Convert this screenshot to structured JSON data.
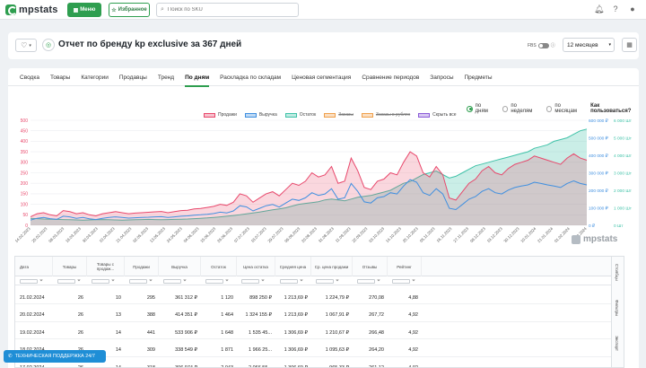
{
  "app": {
    "logo_text": "mpstats",
    "menu_label": "Меню",
    "favorites_label": "Избранное",
    "search_placeholder": "Поиск по SKU"
  },
  "header": {
    "title": "Отчет по бренду kp exclusive за 367 дней",
    "fbs_label": "FBS",
    "period_value": "12 месяцев"
  },
  "tabs": [
    {
      "label": "Сводка",
      "active": false
    },
    {
      "label": "Товары",
      "active": false
    },
    {
      "label": "Категории",
      "active": false
    },
    {
      "label": "Продавцы",
      "active": false
    },
    {
      "label": "Тренд",
      "active": false
    },
    {
      "label": "По дням",
      "active": true
    },
    {
      "label": "Раскладка по складам",
      "active": false
    },
    {
      "label": "Ценовая сегментация",
      "active": false
    },
    {
      "label": "Сравнение периодов",
      "active": false
    },
    {
      "label": "Запросы",
      "active": false
    },
    {
      "label": "Предметы",
      "active": false
    }
  ],
  "granularity": {
    "options": [
      "по дням",
      "по неделям",
      "по месяцам"
    ],
    "selected": "по дням",
    "help_label": "Как пользоваться?"
  },
  "legend": [
    {
      "label": "Продажи",
      "color": "#e8476b",
      "enabled": true
    },
    {
      "label": "Выручка",
      "color": "#3f8fe0",
      "enabled": true
    },
    {
      "label": "Остаток",
      "color": "#3fc2a8",
      "enabled": true
    },
    {
      "label": "Заказы",
      "color": "#f0a04b",
      "enabled": false
    },
    {
      "label": "Заказы в рублях",
      "color": "#f0a04b",
      "enabled": false
    },
    {
      "label": "Скрыть все",
      "color": "#8a5ad8",
      "enabled": true
    }
  ],
  "chart_data": {
    "type": "line",
    "left_axis_ticks": [
      "500",
      "450",
      "400",
      "350",
      "300",
      "250",
      "200",
      "150",
      "100",
      "50",
      "0"
    ],
    "right_axis_rub_ticks": [
      "600 000 ₽",
      "500 000 ₽",
      "400 000 ₽",
      "300 000 ₽",
      "200 000 ₽",
      "100 000 ₽",
      "0 ₽"
    ],
    "right_axis_qty_ticks": [
      "6 000 Шт",
      "5 000 Шт",
      "4 000 Шт",
      "3 000 Шт",
      "2 000 Шт",
      "1 000 Шт",
      "0 Шт"
    ],
    "x_labels": [
      "14.02.2023",
      "25.02.2023",
      "08.03.2023",
      "19.03.2023",
      "30.03.2023",
      "10.04.2023",
      "21.04.2023",
      "02.05.2023",
      "13.05.2023",
      "24.05.2023",
      "04.06.2023",
      "15.06.2023",
      "26.06.2023",
      "07.07.2023",
      "18.07.2023",
      "29.07.2023",
      "09.08.2023",
      "20.08.2023",
      "31.08.2023",
      "11.09.2023",
      "22.09.2023",
      "03.10.2023",
      "14.10.2023",
      "25.10.2023",
      "05.11.2023",
      "16.11.2023",
      "27.11.2023",
      "08.12.2023",
      "19.12.2023",
      "30.12.2023",
      "10.01.2024",
      "21.01.2024",
      "01.02.2024",
      "12.02.2024"
    ],
    "series": [
      {
        "name": "Продажи",
        "axis": "left",
        "values": [
          40,
          55,
          60,
          50,
          45,
          70,
          65,
          55,
          60,
          50,
          45,
          55,
          60,
          65,
          60,
          55,
          58,
          60,
          62,
          64,
          66,
          60,
          65,
          70,
          72,
          78,
          80,
          85,
          90,
          100,
          95,
          110,
          150,
          140,
          110,
          130,
          150,
          160,
          140,
          170,
          200,
          190,
          210,
          250,
          230,
          240,
          280,
          200,
          210,
          320,
          260,
          180,
          170,
          210,
          220,
          250,
          240,
          300,
          350,
          330,
          250,
          230,
          280,
          240,
          130,
          120,
          160,
          200,
          220,
          260,
          280,
          250,
          240,
          270,
          290,
          300,
          310,
          330,
          320,
          310,
          300,
          290,
          320,
          340,
          320,
          310
        ]
      },
      {
        "name": "Выручка",
        "axis": "right_rub",
        "values": [
          30000,
          40000,
          45000,
          38000,
          34000,
          52000,
          48000,
          40000,
          45000,
          37000,
          33000,
          40000,
          45000,
          48000,
          45000,
          41000,
          43000,
          45000,
          46000,
          48000,
          49000,
          45000,
          48000,
          52000,
          54000,
          58000,
          60000,
          63000,
          67000,
          75000,
          71000,
          82000,
          112000,
          105000,
          82000,
          97000,
          112000,
          119000,
          104000,
          127000,
          149000,
          142000,
          157000,
          186000,
          171000,
          179000,
          209000,
          149000,
          157000,
          239000,
          194000,
          134000,
          127000,
          157000,
          164000,
          186000,
          179000,
          224000,
          261000,
          246000,
          186000,
          171000,
          209000,
          179000,
          97000,
          90000,
          119000,
          149000,
          164000,
          194000,
          209000,
          186000,
          179000,
          201000,
          216000,
          224000,
          231000,
          246000,
          239000,
          231000,
          224000,
          216000,
          239000,
          254000,
          239000,
          231000
        ]
      },
      {
        "name": "Остаток",
        "axis": "right_qty",
        "values": [
          400,
          380,
          360,
          350,
          340,
          330,
          320,
          310,
          300,
          310,
          320,
          330,
          320,
          310,
          300,
          310,
          320,
          330,
          340,
          330,
          320,
          330,
          340,
          350,
          360,
          380,
          400,
          420,
          450,
          480,
          520,
          560,
          600,
          650,
          700,
          760,
          820,
          880,
          940,
          1000,
          1100,
          1200,
          1250,
          1300,
          1350,
          1450,
          1500,
          1450,
          1400,
          1500,
          1600,
          1650,
          1700,
          1800,
          1900,
          2000,
          2200,
          2400,
          2500,
          2700,
          2900,
          3000,
          3100,
          2900,
          2700,
          2800,
          3000,
          3200,
          3400,
          3500,
          3600,
          3700,
          3800,
          3900,
          4000,
          4100,
          4200,
          4400,
          4500,
          4600,
          4800,
          4900,
          5000,
          5200,
          5400,
          5500
        ]
      }
    ]
  },
  "table": {
    "columns": [
      "Дата",
      "Товары",
      "Товары с продаж...",
      "Продажи",
      "Выручка",
      "Остаток",
      "Цена остатка",
      "Средняя цена",
      "Ср. цена продажи",
      "Отзывы",
      "Рейтинг"
    ],
    "rows": [
      [
        "21.02.2024",
        "26",
        "10",
        "295",
        "361 312 ₽",
        "1 120",
        "898 250 ₽",
        "1 213,69 ₽",
        "1 224,79 ₽",
        "270,08",
        "4,88"
      ],
      [
        "20.02.2024",
        "26",
        "13",
        "388",
        "414 351 ₽",
        "1 464",
        "1 324 155 ₽",
        "1 213,69 ₽",
        "1 067,91 ₽",
        "267,72",
        "4,92"
      ],
      [
        "19.02.2024",
        "26",
        "14",
        "441",
        "533 906 ₽",
        "1 648",
        "1 535 45...",
        "1 306,69 ₽",
        "1 210,67 ₽",
        "266,48",
        "4,92"
      ],
      [
        "18.02.2024",
        "26",
        "14",
        "309",
        "338 549 ₽",
        "1 871",
        "1 966 25...",
        "1 306,69 ₽",
        "1 095,63 ₽",
        "264,20",
        "4,92"
      ],
      [
        "17.02.2024",
        "26",
        "14",
        "318",
        "306 974 ₽",
        "2 043",
        "2 066 55...",
        "1 306,69 ₽",
        "965,33 ₽",
        "261,12",
        "4,92"
      ]
    ],
    "side_tabs": [
      "Столбцы",
      "Фильтры",
      "Экспорт"
    ]
  },
  "support_label": "ТЕХНИЧЕСКАЯ ПОДДЕРЖКА 24/7",
  "watermark_text": "mpstats"
}
